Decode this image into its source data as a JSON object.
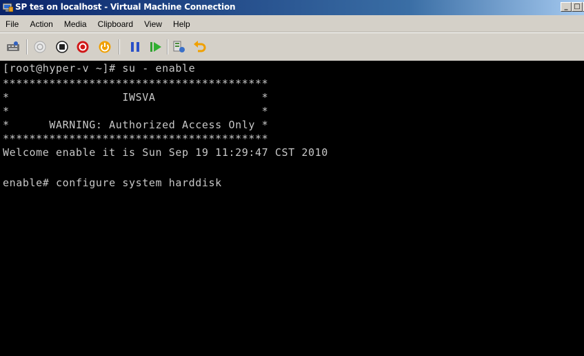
{
  "window": {
    "title": "SP tes on localhost - Virtual Machine Connection",
    "caption_buttons": {
      "minimize": "_",
      "maximize": "□",
      "close": "×"
    }
  },
  "menu": {
    "items": [
      {
        "label": "File"
      },
      {
        "label": "Action"
      },
      {
        "label": "Media"
      },
      {
        "label": "Clipboard"
      },
      {
        "label": "View"
      },
      {
        "label": "Help"
      }
    ]
  },
  "toolbar": {
    "icons": [
      {
        "name": "ctrl-alt-del-icon"
      },
      {
        "name": "start-icon"
      },
      {
        "name": "turn-off-icon"
      },
      {
        "name": "shut-down-icon"
      },
      {
        "name": "power-icon"
      },
      {
        "name": "pause-icon"
      },
      {
        "name": "resume-icon"
      },
      {
        "name": "snapshot-icon"
      },
      {
        "name": "revert-icon"
      }
    ]
  },
  "console": {
    "lines": [
      "[root@hyper-v ~]# su - enable",
      "****************************************",
      "*                 IWSVA                *",
      "*                                      *",
      "*      WARNING: Authorized Access Only *",
      "****************************************",
      "Welcome enable it is Sun Sep 19 11:29:47 CST 2010",
      "",
      "enable# configure system harddisk"
    ]
  },
  "colors": {
    "titlebar_start": "#0a246a",
    "titlebar_end": "#a6caf0",
    "chrome": "#d4d0c8",
    "console_bg": "#000000",
    "console_fg": "#c8c8c8"
  }
}
